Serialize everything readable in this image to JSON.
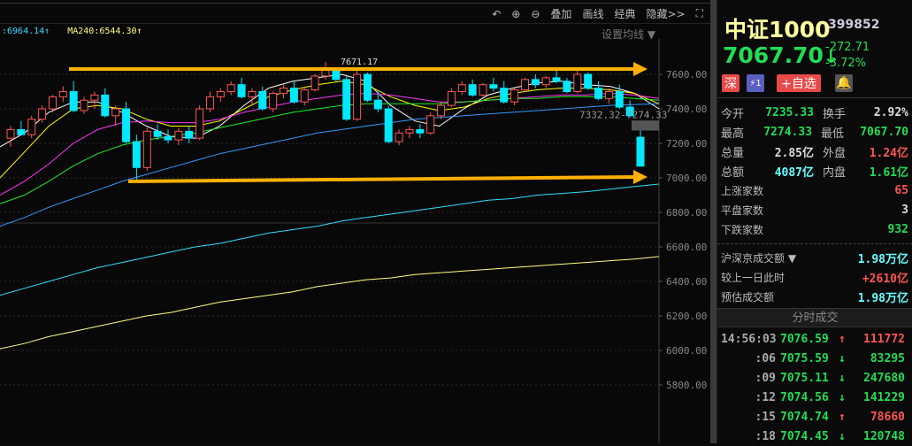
{
  "toolbar": {
    "items": [
      "叠加",
      "画线",
      "经典",
      "隐藏>>"
    ],
    "icons": [
      "undo-icon",
      "zoom-in-icon",
      "zoom-out-icon",
      "fullscreen-icon"
    ]
  },
  "ma_legend": [
    {
      "label": ":6964.14↑",
      "color": "#33ddff"
    },
    {
      "label": "MA240:6544.30↑",
      "color": "#ffff80"
    }
  ],
  "set_ma": "设置均线 ▼",
  "chart_data": {
    "type": "candlestick",
    "y_ticks": [
      7600,
      7400,
      7200,
      7000,
      6800,
      6600,
      6400,
      6200,
      6000,
      5800
    ],
    "y_tick_labels": [
      "7600.00",
      "7400.00",
      "7200.00",
      "7000.00",
      "6800.00",
      "6600.00",
      "6400.00",
      "6200.00",
      "6000.00",
      "5800.00"
    ],
    "ylim": [
      5700,
      7800
    ],
    "high_label": "7671.17",
    "gap_label": "7332.32-7274.33",
    "gap": [
      7274.33,
      7332.32
    ],
    "up_color": "#ff5555",
    "down_color": "#00e8ff",
    "candles": [
      [
        7230,
        7300,
        7180,
        7280
      ],
      [
        7280,
        7330,
        7250,
        7250
      ],
      [
        7250,
        7360,
        7230,
        7340
      ],
      [
        7340,
        7420,
        7320,
        7400
      ],
      [
        7400,
        7480,
        7380,
        7470
      ],
      [
        7470,
        7530,
        7440,
        7500
      ],
      [
        7500,
        7560,
        7380,
        7390
      ],
      [
        7390,
        7470,
        7370,
        7450
      ],
      [
        7450,
        7500,
        7400,
        7480
      ],
      [
        7480,
        7520,
        7350,
        7360
      ],
      [
        7360,
        7420,
        7300,
        7400
      ],
      [
        7400,
        7440,
        7200,
        7210
      ],
      [
        7210,
        7250,
        6990,
        7060
      ],
      [
        7060,
        7290,
        7040,
        7270
      ],
      [
        7270,
        7310,
        7220,
        7240
      ],
      [
        7240,
        7280,
        7200,
        7220
      ],
      [
        7220,
        7290,
        7190,
        7270
      ],
      [
        7270,
        7300,
        7200,
        7230
      ],
      [
        7230,
        7420,
        7220,
        7400
      ],
      [
        7400,
        7500,
        7380,
        7470
      ],
      [
        7470,
        7520,
        7440,
        7500
      ],
      [
        7500,
        7560,
        7480,
        7540
      ],
      [
        7540,
        7580,
        7460,
        7470
      ],
      [
        7470,
        7520,
        7420,
        7500
      ],
      [
        7500,
        7530,
        7390,
        7400
      ],
      [
        7400,
        7500,
        7380,
        7490
      ],
      [
        7490,
        7540,
        7460,
        7520
      ],
      [
        7520,
        7560,
        7430,
        7440
      ],
      [
        7440,
        7520,
        7420,
        7510
      ],
      [
        7510,
        7600,
        7500,
        7590
      ],
      [
        7590,
        7671,
        7570,
        7630
      ],
      [
        7630,
        7640,
        7560,
        7570
      ],
      [
        7570,
        7590,
        7330,
        7340
      ],
      [
        7340,
        7620,
        7330,
        7600
      ],
      [
        7600,
        7610,
        7440,
        7450
      ],
      [
        7450,
        7500,
        7380,
        7400
      ],
      [
        7400,
        7420,
        7200,
        7210
      ],
      [
        7210,
        7280,
        7190,
        7260
      ],
      [
        7260,
        7300,
        7230,
        7280
      ],
      [
        7280,
        7310,
        7230,
        7260
      ],
      [
        7260,
        7380,
        7250,
        7360
      ],
      [
        7360,
        7440,
        7340,
        7420
      ],
      [
        7420,
        7520,
        7410,
        7500
      ],
      [
        7500,
        7560,
        7480,
        7540
      ],
      [
        7540,
        7570,
        7470,
        7480
      ],
      [
        7480,
        7550,
        7470,
        7540
      ],
      [
        7540,
        7580,
        7500,
        7520
      ],
      [
        7520,
        7560,
        7430,
        7440
      ],
      [
        7440,
        7520,
        7420,
        7510
      ],
      [
        7510,
        7580,
        7500,
        7570
      ],
      [
        7570,
        7600,
        7520,
        7540
      ],
      [
        7540,
        7590,
        7520,
        7580
      ],
      [
        7580,
        7620,
        7550,
        7560
      ],
      [
        7560,
        7580,
        7490,
        7500
      ],
      [
        7500,
        7620,
        7490,
        7600
      ],
      [
        7600,
        7610,
        7510,
        7520
      ],
      [
        7520,
        7560,
        7450,
        7460
      ],
      [
        7460,
        7520,
        7430,
        7500
      ],
      [
        7500,
        7540,
        7400,
        7410
      ],
      [
        7410,
        7450,
        7350,
        7360
      ],
      [
        7235.33,
        7274.33,
        7067.7,
        7067.7
      ]
    ],
    "ma_lines": [
      {
        "name": "MA5",
        "color": "#ffffff",
        "values": [
          7180,
          7260,
          7380,
          7440,
          7440,
          7380,
          7300,
          7240,
          7230,
          7300,
          7420,
          7520,
          7560,
          7580,
          7600,
          7560,
          7420,
          7330,
          7300,
          7400,
          7480,
          7520,
          7550,
          7560,
          7540,
          7530,
          7490,
          7400
        ]
      },
      {
        "name": "MA10",
        "color": "#ffff00",
        "values": [
          7000,
          7150,
          7300,
          7400,
          7420,
          7400,
          7340,
          7300,
          7300,
          7330,
          7400,
          7470,
          7510,
          7540,
          7560,
          7540,
          7470,
          7420,
          7390,
          7410,
          7460,
          7490,
          7510,
          7520,
          7520,
          7510,
          7490,
          7430
        ]
      },
      {
        "name": "MA20",
        "color": "#ff33ff",
        "values": [
          6900,
          6980,
          7080,
          7200,
          7280,
          7320,
          7330,
          7320,
          7320,
          7340,
          7380,
          7410,
          7440,
          7460,
          7480,
          7490,
          7480,
          7460,
          7440,
          7440,
          7450,
          7460,
          7470,
          7480,
          7480,
          7490,
          7480,
          7460
        ]
      },
      {
        "name": "MA30",
        "color": "#22ee22",
        "values": [
          6850,
          6900,
          6980,
          7070,
          7140,
          7190,
          7220,
          7240,
          7260,
          7290,
          7320,
          7350,
          7380,
          7400,
          7420,
          7430,
          7430,
          7430,
          7430,
          7440,
          7450,
          7460,
          7460,
          7470,
          7470,
          7470,
          7460,
          7450
        ]
      },
      {
        "name": "MA60",
        "color": "#3399ff",
        "values": [
          6720,
          6770,
          6830,
          6880,
          6930,
          6980,
          7020,
          7060,
          7100,
          7140,
          7170,
          7200,
          7230,
          7260,
          7280,
          7300,
          7320,
          7340,
          7350,
          7360,
          7370,
          7380,
          7390,
          7400,
          7410,
          7420,
          7425,
          7430
        ]
      },
      {
        "name": "MA120",
        "color": "#33ddff",
        "values": [
          6320,
          6360,
          6400,
          6440,
          6480,
          6510,
          6540,
          6570,
          6600,
          6620,
          6650,
          6680,
          6700,
          6720,
          6750,
          6770,
          6790,
          6810,
          6830,
          6850,
          6870,
          6880,
          6900,
          6910,
          6920,
          6935,
          6950,
          6964.14
        ]
      },
      {
        "name": "MA240",
        "color": "#ffff80",
        "values": [
          6010,
          6040,
          6080,
          6110,
          6140,
          6170,
          6200,
          6220,
          6250,
          6280,
          6300,
          6320,
          6340,
          6370,
          6390,
          6410,
          6420,
          6440,
          6450,
          6460,
          6470,
          6480,
          6490,
          6500,
          6510,
          6520,
          6530,
          6544.3
        ]
      }
    ]
  },
  "quote": {
    "name": "中证1000",
    "code": "399852",
    "price": "7067.70",
    "arrow": "↓",
    "change": "-272.71",
    "change_pct": "-3.72%",
    "badges": {
      "market": "深",
      "flash": "1",
      "add_watch": "+自选"
    },
    "stats": [
      [
        "今开",
        "7235.33",
        "g",
        "换手",
        "2.92%",
        "w"
      ],
      [
        "最高",
        "7274.33",
        "g",
        "最低",
        "7067.70",
        "g"
      ],
      [
        "总量",
        "2.85亿",
        "w",
        "外盘",
        "1.24亿",
        "r"
      ],
      [
        "总额",
        "4087亿",
        "c",
        "内盘",
        "1.61亿",
        "g"
      ]
    ],
    "breadth": [
      [
        "上涨家数",
        "65",
        "r"
      ],
      [
        "平盘家数",
        "3",
        "w"
      ],
      [
        "下跌家数",
        "932",
        "g"
      ]
    ],
    "turnover": [
      [
        "沪深京成交额 ▼",
        "1.98万亿",
        "c"
      ],
      [
        "较上一日此时",
        "+2610亿",
        "r"
      ],
      [
        "预估成交额",
        "1.98万亿",
        "c"
      ]
    ]
  },
  "ticks_header": "分时成交",
  "ticks": [
    [
      "14:56:03",
      "7076.59",
      "↑",
      "111772",
      "r"
    ],
    [
      ":06",
      "7075.59",
      "↓",
      "83295",
      "g"
    ],
    [
      ":09",
      "7075.11",
      "↓",
      "247680",
      "g"
    ],
    [
      ":12",
      "7074.56",
      "↓",
      "141229",
      "g"
    ],
    [
      ":15",
      "7074.74",
      "↑",
      "78660",
      "r"
    ],
    [
      ":18",
      "7074.45",
      "↓",
      "120748",
      "g"
    ]
  ]
}
